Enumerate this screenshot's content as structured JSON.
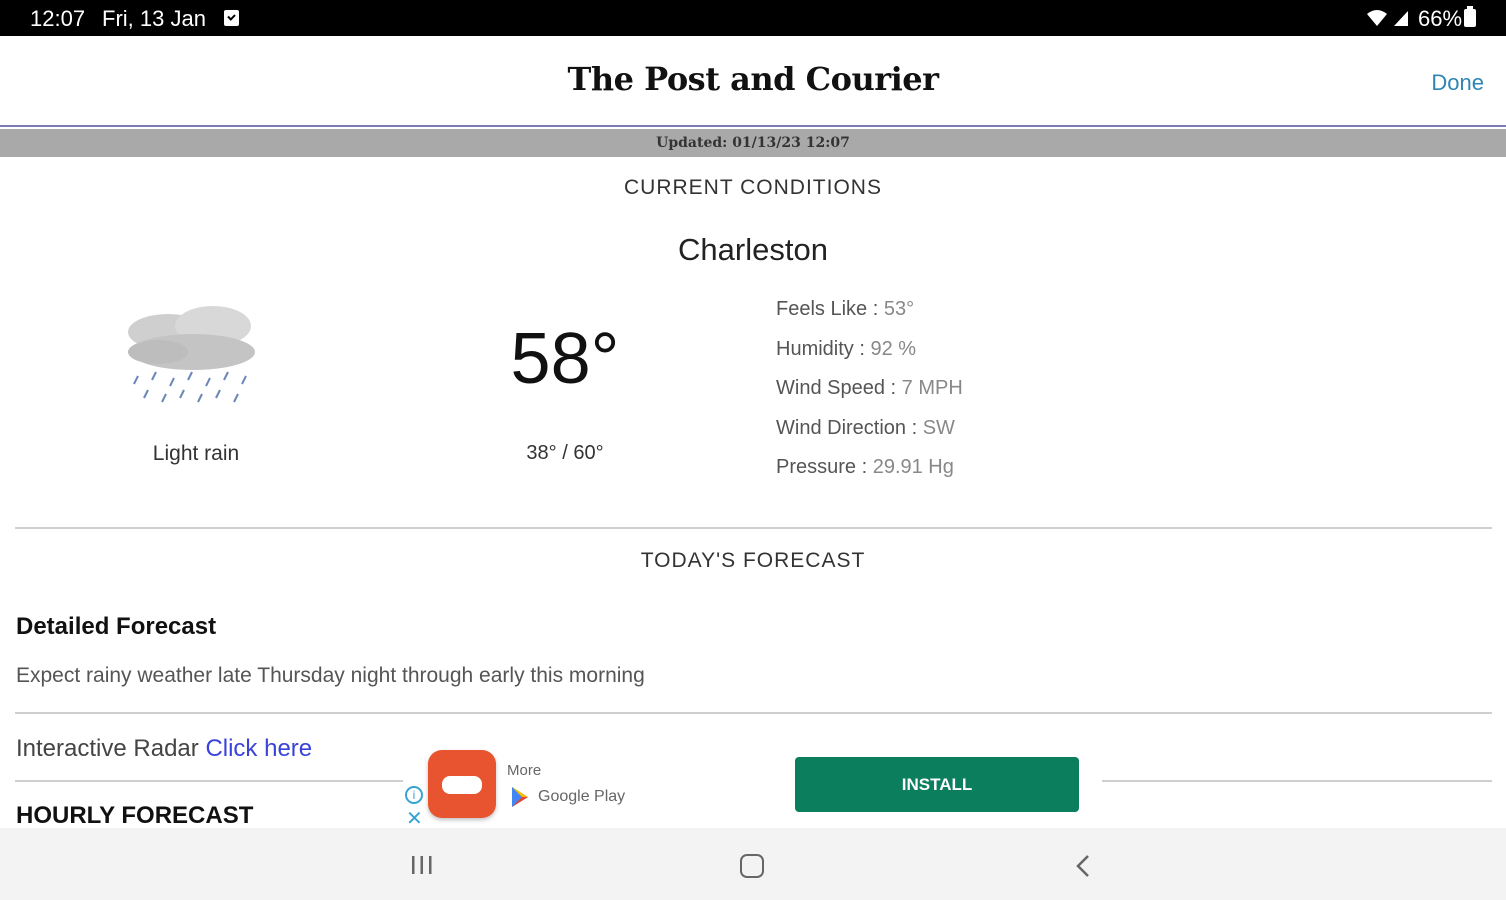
{
  "status_bar": {
    "time": "12:07",
    "date": "Fri, 13 Jan",
    "battery": "66%"
  },
  "header": {
    "title": "The Post and Courier",
    "done_label": "Done"
  },
  "updated": "Updated: 01/13/23 12:07",
  "current": {
    "section_title": "CURRENT CONDITIONS",
    "city": "Charleston",
    "icon": "light-rain-icon",
    "condition": "Light rain",
    "temperature": "58°",
    "low_high": "38° / 60°",
    "details": [
      {
        "label": "Feels Like",
        "value": "53°"
      },
      {
        "label": "Humidity",
        "value": "92 %"
      },
      {
        "label": "Wind Speed",
        "value": "7 MPH"
      },
      {
        "label": "Wind Direction",
        "value": "SW"
      },
      {
        "label": "Pressure",
        "value": "29.91 Hg"
      }
    ]
  },
  "today": {
    "section_title": "TODAY'S FORECAST",
    "detailed_heading": "Detailed Forecast",
    "detailed_text": "Expect rainy weather late Thursday night through early this morning"
  },
  "radar": {
    "label": "Interactive Radar",
    "link": "Click here"
  },
  "hourly_heading": "HOURLY FORECAST",
  "ad": {
    "more_label": "More",
    "store_label": "Google Play",
    "install_label": "INSTALL"
  },
  "colors": {
    "accent_link": "#2f86b4",
    "radar_link": "#3a43d9",
    "install_bg": "#0b7e5e",
    "header_rule": "#7d7ab8"
  }
}
